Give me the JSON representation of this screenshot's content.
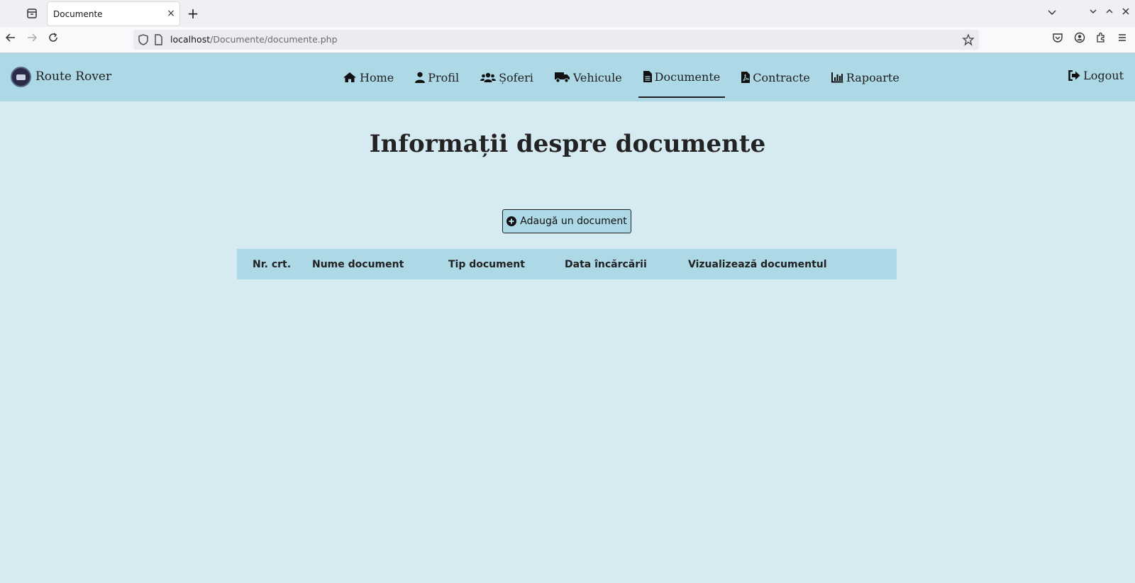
{
  "browser": {
    "tab_title": "Documente",
    "url_host": "localhost",
    "url_path": "/Documente/documente.php",
    "new_tab_symbol": "+",
    "close_tab_symbol": "×"
  },
  "app": {
    "brand": "Route Rover",
    "menu": [
      {
        "label": "Home",
        "icon": "home-icon"
      },
      {
        "label": "Profil",
        "icon": "user-icon"
      },
      {
        "label": "Șoferi",
        "icon": "users-icon"
      },
      {
        "label": "Vehicule",
        "icon": "truck-icon"
      },
      {
        "label": "Documente",
        "icon": "file-icon",
        "active": true
      },
      {
        "label": "Contracte",
        "icon": "file-pdf-icon"
      },
      {
        "label": "Rapoarte",
        "icon": "chart-icon"
      }
    ],
    "logout": "Logout"
  },
  "main": {
    "title": "Informații despre documente",
    "add_button": "Adaugă un document",
    "table_headers": [
      "Nr. crt.",
      "Nume document",
      "Tip document",
      "Data încărcării",
      "Vizualizează documentul"
    ]
  },
  "colors": {
    "nav_bg": "#add8e6",
    "page_bg": "#d6eaf1"
  }
}
